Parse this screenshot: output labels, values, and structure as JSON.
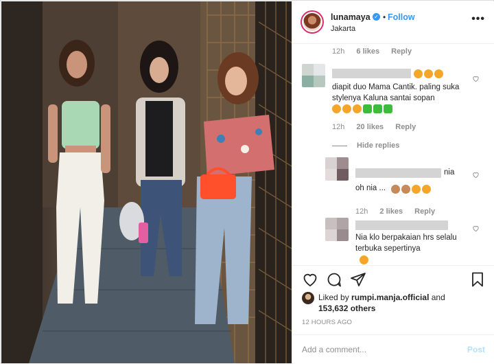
{
  "post": {
    "username": "lunamaya",
    "separator": "•",
    "follow_label": "Follow",
    "location": "Jakarta",
    "more_label": "•••"
  },
  "comments": {
    "top_meta": {
      "time": "12h",
      "likes": "6 likes",
      "reply": "Reply"
    },
    "c1": {
      "text_emoji_tail": "",
      "text": "diapit duo Mama Cantik. paling suka stylenya Kaluna santai sopan",
      "meta": {
        "time": "12h",
        "likes": "20 likes",
        "reply": "Reply"
      }
    },
    "hide_replies": "Hide replies",
    "r1": {
      "name_tail": "nia",
      "text": "oh nia ...",
      "meta": {
        "time": "12h",
        "likes": "2 likes",
        "reply": "Reply"
      }
    },
    "r2": {
      "text": "Nia klo berpakaian hrs selalu terbuka sepertinya"
    }
  },
  "actions": {
    "liked_prefix": "Liked by",
    "liked_user": "rumpi.manja.official",
    "liked_and": "and",
    "liked_count": "153,632 others",
    "time_ago": "12 HOURS AGO",
    "add_placeholder": "Add a comment...",
    "post_label": "Post"
  },
  "icons": {
    "like": "heart-outline-icon",
    "comment": "comment-bubble-icon",
    "share": "paper-plane-icon",
    "save": "bookmark-icon",
    "verified": "verified-badge-icon"
  },
  "colors": {
    "link_blue": "#3897f0",
    "muted": "#8e8e8e",
    "post_disabled": "#b2dffc"
  }
}
